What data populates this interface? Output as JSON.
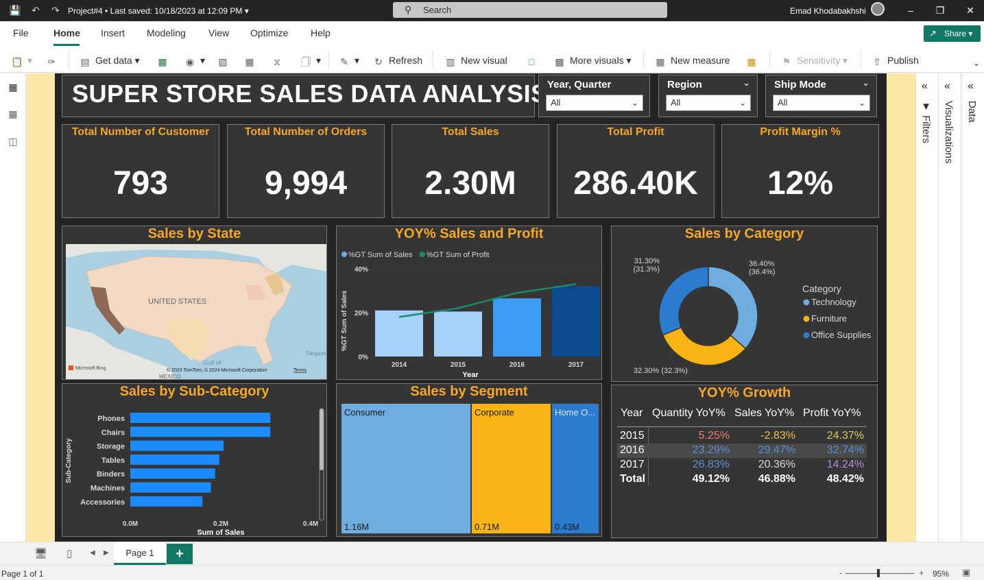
{
  "titlebar": {
    "project": "Project#4",
    "saved": "•  Last saved: 10/18/2023 at 12:09 PM",
    "search_placeholder": "Search",
    "user": "Emad Khodabakhshi"
  },
  "tabs": [
    "File",
    "Home",
    "Insert",
    "Modeling",
    "View",
    "Optimize",
    "Help"
  ],
  "share_label": "Share",
  "toolbar": {
    "get_data": "Get data",
    "refresh": "Refresh",
    "new_visual": "New visual",
    "more_visuals": "More visuals",
    "new_measure": "New measure",
    "sensitivity": "Sensitivity",
    "publish": "Publish"
  },
  "report": {
    "title": "SUPER STORE SALES DATA ANALYSIS",
    "slicers": [
      {
        "title": "Year, Quarter",
        "value": "All"
      },
      {
        "title": "Region",
        "value": "All"
      },
      {
        "title": "Ship Mode",
        "value": "All"
      }
    ],
    "kpis": [
      {
        "title": "Total Number of Customer",
        "value": "793"
      },
      {
        "title": "Total Number of Orders",
        "value": "9,994"
      },
      {
        "title": "Total Sales",
        "value": "2.30M"
      },
      {
        "title": "Total Profit",
        "value": "286.40K"
      },
      {
        "title": "Profit Margin %",
        "value": "12%"
      }
    ],
    "map": {
      "title": "Sales by State",
      "country_label": "UNITED STATES",
      "gulf_label": "Gulf of",
      "mexico_label": "MEXICO",
      "sargasso_label": "Sargass",
      "bing_label": "Microsoft Bing",
      "copyright": "© 2023 TomTom, © 2024 Microsoft Corporation",
      "terms": "Terms"
    },
    "segment": {
      "title": "Sales by Segment",
      "cells": [
        {
          "label": "Consumer",
          "value": "1.16M",
          "color": "#6fade0"
        },
        {
          "label": "Corporate",
          "value": "0.71M",
          "color": "#f9b315"
        },
        {
          "label": "Home O...",
          "value": "0.43M",
          "color": "#2b7bd1"
        }
      ]
    },
    "yoy_growth": {
      "title": "YOY% Growth",
      "headers": [
        "Year",
        "Quantity YoY%",
        "Sales YoY%",
        "Profit YoY%"
      ],
      "rows": [
        {
          "year": "2015",
          "q": "5.25%",
          "s": "-2.83%",
          "p": "24.37%",
          "qc": "#f07b6a",
          "sc": "#e8c24a",
          "pc": "#d7cf58"
        },
        {
          "year": "2016",
          "q": "23.29%",
          "s": "29.47%",
          "p": "32.74%",
          "qc": "#5b8fd6",
          "sc": "#5b8fd6",
          "pc": "#5b8fd6"
        },
        {
          "year": "2017",
          "q": "26.83%",
          "s": "20.36%",
          "p": "14.24%",
          "qc": "#5b8fd6",
          "sc": "#d8d8d8",
          "pc": "#b68cdd"
        }
      ],
      "total": {
        "year": "Total",
        "q": "49.12%",
        "s": "46.88%",
        "p": "48.42%"
      }
    }
  },
  "panes": {
    "filters": "Filters",
    "visualizations": "Visualizations",
    "data": "Data"
  },
  "pagebar": {
    "page": "Page 1",
    "add": "+"
  },
  "statusbar": {
    "page_of": "Page 1 of 1",
    "zoom": "95%"
  },
  "chart_data": [
    {
      "type": "bar",
      "title": "YOY% Sales and Profit",
      "categories": [
        "2014",
        "2015",
        "2016",
        "2017"
      ],
      "series": [
        {
          "name": "%GT Sum of Sales",
          "values": [
            21,
            20.5,
            26.5,
            32
          ],
          "colors": [
            "#a6d1fb",
            "#a6d1fb",
            "#3f9cf5",
            "#0b4a8f"
          ]
        },
        {
          "name": "%GT Sum of Profit",
          "values": [
            18,
            22,
            29,
            33
          ],
          "color": "#1b8a6b"
        }
      ],
      "xlabel": "Year",
      "ylabel": "%GT Sum of Sales",
      "yticks": [
        "0%",
        "20%",
        "40%"
      ],
      "ylim": [
        0,
        40
      ]
    },
    {
      "type": "pie",
      "title": "Sales by Category",
      "legend_title": "Category",
      "slices": [
        {
          "name": "Technology",
          "value": 36.4,
          "label": "36.40%",
          "sub": "(36.4%)",
          "color": "#6fade0"
        },
        {
          "name": "Furniture",
          "value": 32.3,
          "label": "32.30% (32.3%)",
          "color": "#f9b315"
        },
        {
          "name": "Office Supplies",
          "value": 31.3,
          "label": "31.30%",
          "sub": "(31.3%)",
          "color": "#2b7bd1"
        }
      ]
    },
    {
      "type": "bar",
      "title": "Sales by Sub-Category",
      "orientation": "horizontal",
      "categories": [
        "Phones",
        "Chairs",
        "Storage",
        "Tables",
        "Binders",
        "Machines",
        "Accessories"
      ],
      "values": [
        0.33,
        0.33,
        0.22,
        0.21,
        0.2,
        0.19,
        0.17
      ],
      "xlabel": "Sum of Sales",
      "ylabel": "Sub-Category",
      "xticks": [
        "0.0M",
        "0.2M",
        "0.4M"
      ],
      "xlim": [
        0,
        0.43
      ],
      "color": "#1a8cff"
    }
  ]
}
